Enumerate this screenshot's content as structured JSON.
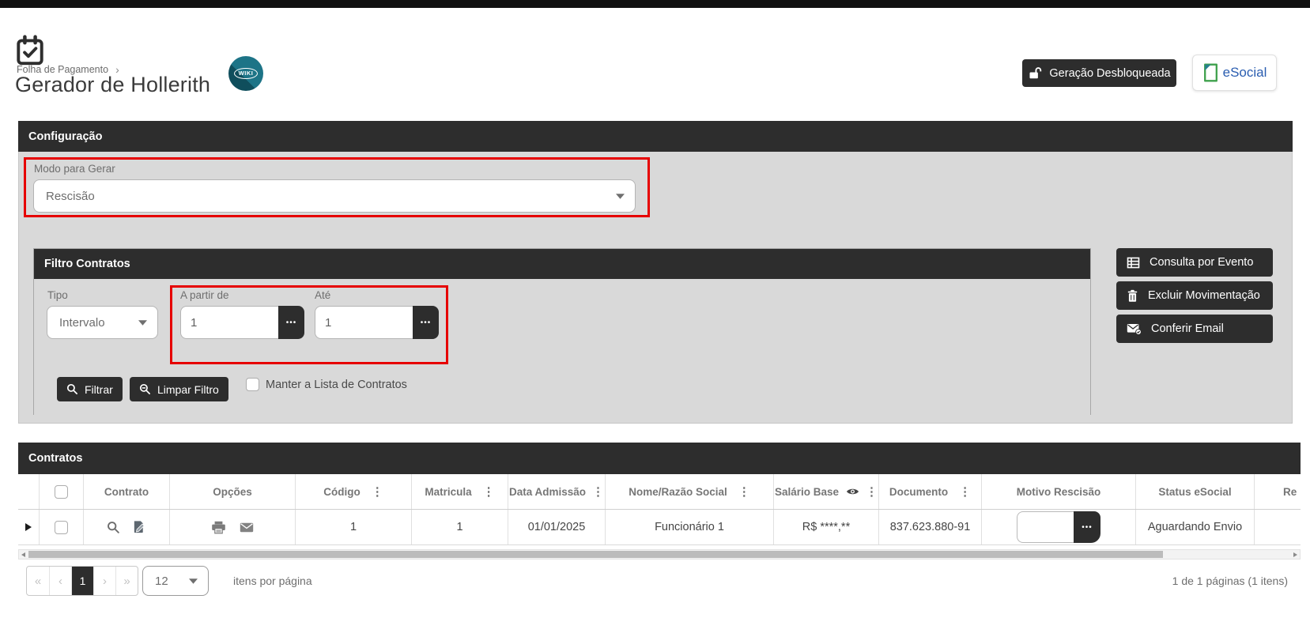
{
  "header": {
    "breadcrumb": "Folha de Pagamento",
    "breadcrumb_separator": "›",
    "title": "Gerador de Hollerith",
    "wiki_label": "WIKI",
    "generation_button": "Geração Desbloqueada",
    "esocial_label": "eSocial"
  },
  "config": {
    "title": "Configuração",
    "modo": {
      "label": "Modo para Gerar",
      "value": "Rescisão"
    },
    "filtro": {
      "title": "Filtro Contratos",
      "tipo": {
        "label": "Tipo",
        "value": "Intervalo"
      },
      "from": {
        "label": "A partir de",
        "value": "1"
      },
      "to": {
        "label": "Até",
        "value": "1"
      },
      "filtrar_button": "Filtrar",
      "limpar_button": "Limpar Filtro",
      "manter_checkbox_label": "Manter a Lista de Contratos"
    },
    "actions": {
      "consulta": "Consulta por Evento",
      "excluir": "Excluir Movimentação",
      "conferir": "Conferir Email"
    }
  },
  "grid": {
    "title": "Contratos",
    "columns": {
      "contrato": "Contrato",
      "opcoes": "Opções",
      "codigo": "Código",
      "matricula": "Matricula",
      "data_admissao": "Data Admissão",
      "nome": "Nome/Razão Social",
      "salario": "Salário Base",
      "documento": "Documento",
      "motivo": "Motivo Rescisão",
      "status": "Status eSocial",
      "re_partial": "Re"
    },
    "row": {
      "codigo": "1",
      "matricula": "1",
      "data_admissao": "01/01/2025",
      "nome": "Funcionário 1",
      "salario": "R$ ****,**",
      "documento": "837.623.880-91",
      "status": "Aguardando Envio"
    },
    "pager": {
      "first": "«",
      "prev": "‹",
      "page": "1",
      "next": "›",
      "last": "»",
      "page_size": "12",
      "items_per_page_label": "itens por página",
      "summary": "1 de 1 páginas (1 itens)"
    }
  },
  "ui": {
    "more_glyph": "•••",
    "column_menu_glyph": "⋮"
  },
  "colors": {
    "bar_dark": "#2d2d2d",
    "panel_gray": "#d9d9d9",
    "highlight_red": "#e60000",
    "esocial_blue": "#2a5db0",
    "wiki_teal": "#1d7487"
  }
}
